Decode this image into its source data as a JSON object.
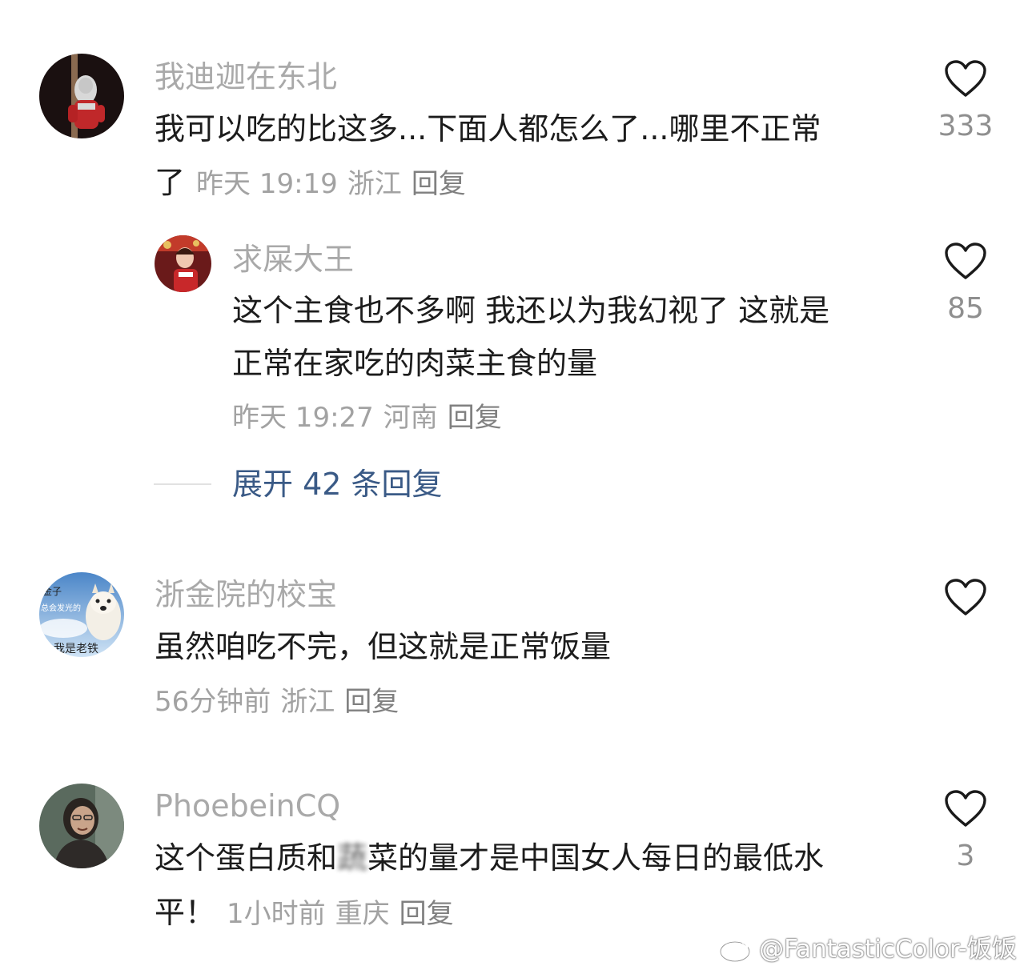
{
  "comments": [
    {
      "username": "我迪迦在东北",
      "avatar": "avatar-ultraman",
      "body_lines": [
        "我可以吃的比这多...下面人都怎么了...哪里不正常",
        "了"
      ],
      "time": "昨天 19:19",
      "location": "浙江",
      "reply_label": "回复",
      "likes": "333"
    },
    {
      "username": "求屎大王",
      "avatar": "avatar-performer",
      "body_lines": [
        "这个主食也不多啊 我还以为我幻视了 这就是",
        "正常在家吃的肉菜主食的量"
      ],
      "time": "昨天 19:27",
      "location": "河南",
      "reply_label": "回复",
      "likes": "85"
    },
    {
      "username": "浙金院的校宝",
      "avatar": "avatar-dog",
      "avatar_text": [
        "金子",
        "总会发光的",
        "我是老铁"
      ],
      "body_lines": [
        "虽然咱吃不完，但这就是正常饭量"
      ],
      "time": "56分钟前",
      "location": "浙江",
      "reply_label": "回复",
      "likes": ""
    },
    {
      "username": "PhoebeinCQ",
      "avatar": "avatar-woman",
      "body_pre": "这个蛋白质和",
      "body_blur": "蔬",
      "body_post": "菜的量才是中国女人每日的最低水",
      "body_line2": "平！",
      "time": "1小时前",
      "location": "重庆",
      "reply_label": "回复",
      "likes": "3"
    }
  ],
  "expand_replies": "展开 42 条回复",
  "watermark": "@FantasticColor-饭饭",
  "colors": {
    "username": "#a9a9a9",
    "body": "#1c1c1c",
    "meta": "#a2a2a2",
    "expand": "#3a5a86",
    "heart": "#1a1a1a"
  }
}
